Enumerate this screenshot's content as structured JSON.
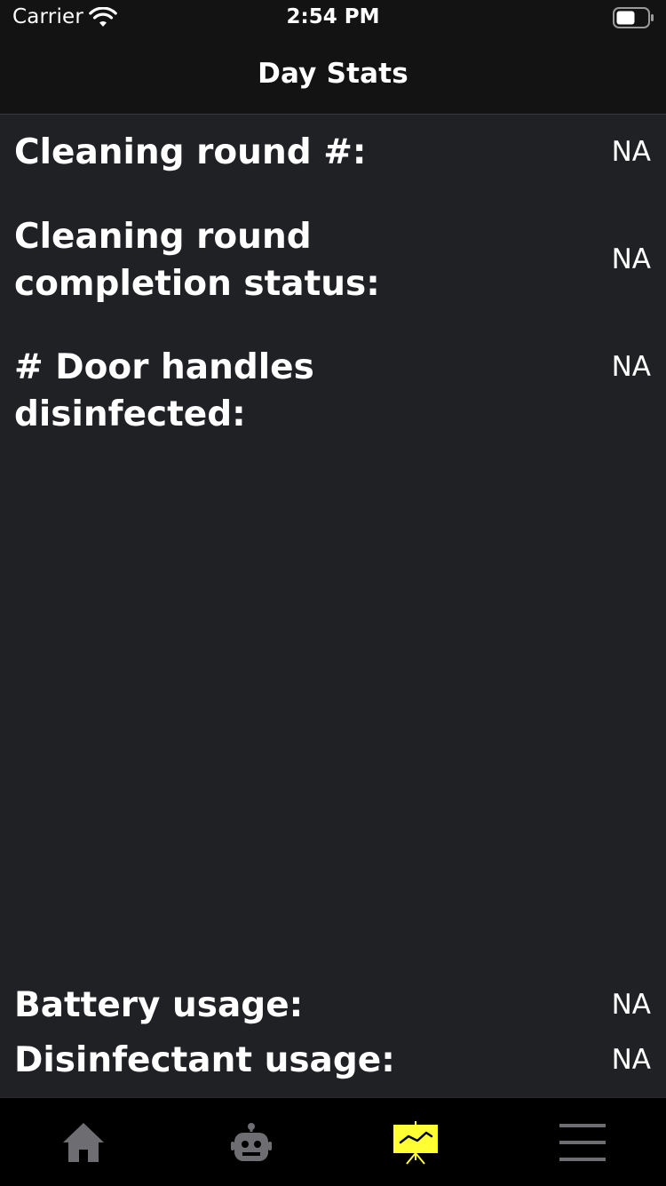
{
  "status_bar": {
    "carrier": "Carrier",
    "time": "2:54 PM"
  },
  "nav": {
    "title": "Day Stats"
  },
  "stats": {
    "cleaning_round": {
      "label": "Cleaning round #:",
      "value": "NA"
    },
    "completion_status": {
      "label_line1": "Cleaning round",
      "label_line2": "completion status:",
      "value": "NA"
    },
    "door_handles": {
      "label": "# Door handles disinfected:",
      "value": "NA"
    },
    "battery_usage": {
      "label": "Battery usage:",
      "value": "NA"
    },
    "disinfectant_usage": {
      "label": "Disinfectant usage:",
      "value": "NA"
    }
  },
  "tab_bar": {
    "tabs": [
      {
        "icon": "home-icon",
        "selected": false
      },
      {
        "icon": "robot-icon",
        "selected": false
      },
      {
        "icon": "stats-chart-icon",
        "selected": true
      },
      {
        "icon": "menu-icon",
        "selected": false
      }
    ]
  },
  "colors": {
    "background": "#202125",
    "header": "#131313",
    "tab_bar": "#000000",
    "accent": "#FFFF33",
    "icon_inactive": "#6e6e72"
  }
}
